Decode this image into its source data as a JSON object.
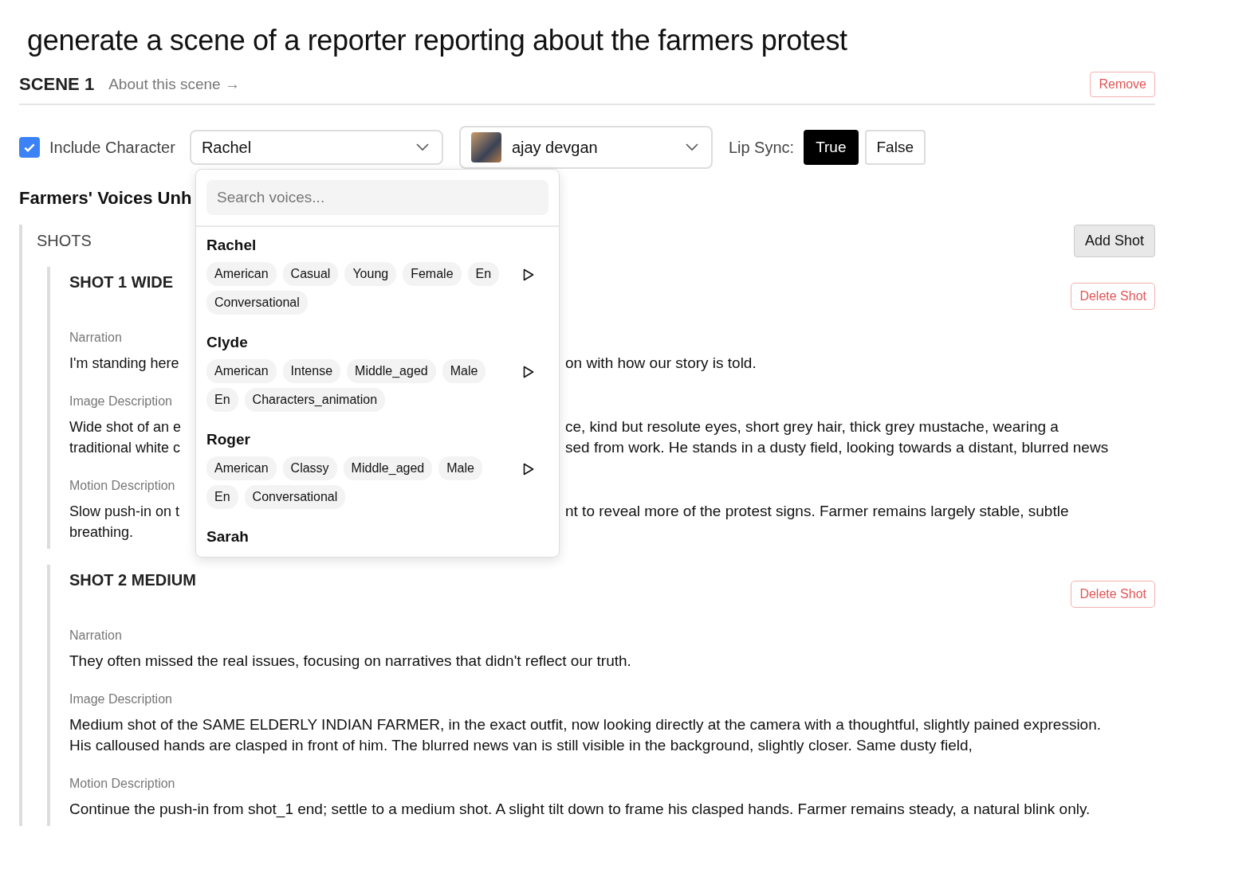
{
  "prompt": "generate a scene of a reporter reporting about the farmers protest",
  "scene": {
    "title": "SCENE 1",
    "about_link": "About this scene →",
    "remove_button": "Remove"
  },
  "controls": {
    "include_character": {
      "label": "Include Character",
      "checked": true
    },
    "voice_select": {
      "value": "Rachel",
      "expanded": true
    },
    "character_select": {
      "value": "ajay devgan"
    },
    "lip_sync": {
      "label": "Lip Sync:",
      "options": [
        {
          "label": "True",
          "selected": true
        },
        {
          "label": "False",
          "selected": false
        }
      ]
    }
  },
  "voice_dropdown": {
    "search_placeholder": "Search voices...",
    "voices": [
      {
        "name": "Rachel",
        "tags": [
          "American",
          "Casual",
          "Young",
          "Female",
          "En",
          "Conversational"
        ]
      },
      {
        "name": "Clyde",
        "tags": [
          "American",
          "Intense",
          "Middle_aged",
          "Male",
          "En",
          "Characters_animation"
        ]
      },
      {
        "name": "Roger",
        "tags": [
          "American",
          "Classy",
          "Middle_aged",
          "Male",
          "En",
          "Conversational"
        ]
      },
      {
        "name": "Sarah"
      }
    ]
  },
  "scene_heading": "Farmers' Voices Unh",
  "shots_section": {
    "label": "SHOTS",
    "add_button": "Add Shot",
    "shots": [
      {
        "title": "SHOT 1 WIDE",
        "delete_button": "Delete Shot",
        "fields": [
          {
            "label": "Narration",
            "lines": [
              {
                "left": "I'm standing here",
                "right": "on with how our story is told."
              }
            ]
          },
          {
            "label": "Image Description",
            "lines": [
              {
                "left": "Wide shot of an e",
                "right": "ce, kind but resolute eyes, short grey hair, thick grey mustache, wearing a"
              },
              {
                "left": "traditional white c",
                "right": "sed from work. He stands in a dusty field, looking towards a distant, blurred news"
              }
            ]
          },
          {
            "label": "Motion Description",
            "lines": [
              {
                "left": "Slow push-in on t",
                "right": "nt to reveal more of the protest signs. Farmer remains largely stable, subtle"
              },
              {
                "left": "breathing."
              }
            ]
          }
        ]
      },
      {
        "title": "SHOT 2 MEDIUM",
        "delete_button": "Delete Shot",
        "fields": [
          {
            "label": "Narration",
            "text": "They often missed the real issues, focusing on narratives that didn't reflect our truth."
          },
          {
            "label": "Image Description",
            "text": "Medium shot of the SAME ELDERLY INDIAN FARMER, in the exact outfit, now looking directly at the camera with a thoughtful, slightly pained expression. His calloused hands are clasped in front of him. The blurred news van is still visible in the background, slightly closer. Same dusty field,"
          },
          {
            "label": "Motion Description",
            "text": "Continue the push-in from shot_1 end; settle to a medium shot. A slight tilt down to frame his clasped hands. Farmer remains steady, a natural blink only."
          }
        ]
      }
    ]
  }
}
